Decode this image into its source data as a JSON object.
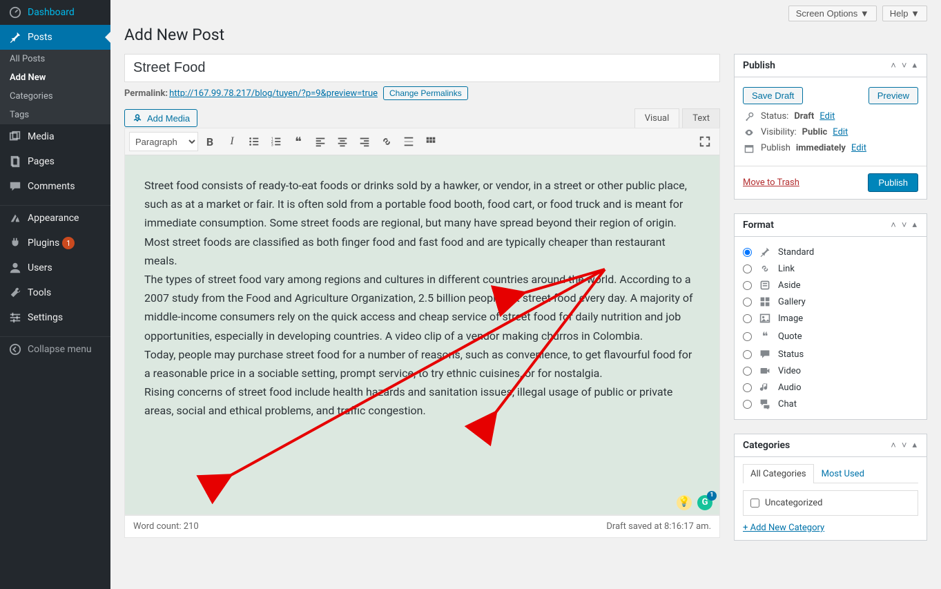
{
  "topbar": {
    "screen_options": "Screen Options ▼",
    "help": "Help ▼"
  },
  "sidebar": {
    "dashboard": "Dashboard",
    "posts": "Posts",
    "posts_submenu": [
      "All Posts",
      "Add New",
      "Categories",
      "Tags"
    ],
    "media": "Media",
    "pages": "Pages",
    "comments": "Comments",
    "appearance": "Appearance",
    "plugins": "Plugins",
    "plugins_badge": "1",
    "users": "Users",
    "tools": "Tools",
    "settings": "Settings",
    "collapse": "Collapse menu"
  },
  "page": {
    "title": "Add New Post"
  },
  "post": {
    "title": "Street Food",
    "permalink_label": "Permalink:",
    "permalink_url": "http://167.99.78.217/blog/tuyen/?p=9&preview=true",
    "change_permalinks": "Change Permalinks",
    "add_media": "Add Media",
    "tabs": {
      "visual": "Visual",
      "text": "Text"
    },
    "format_select": "Paragraph",
    "body": {
      "p1": "Street food consists of ready-to-eat foods or drinks sold by a hawker, or vendor, in a street or other public place, such as at a market or fair. It is often sold from a portable food booth, food cart, or food truck and is meant for immediate consumption. Some street foods are regional, but many have spread beyond their region of origin. Most street foods are classified as both finger food and fast food and are typically cheaper than restaurant meals.",
      "p2": "The types of street food vary among regions and cultures in different countries around the world. According to a 2007 study from the Food and Agriculture Organization, 2.5 billion people eat street food every day. A majority of middle-income consumers rely on the quick access and cheap service of street food for daily nutrition and job opportunities, especially in developing countries. A video clip of a vendor making churros in Colombia.",
      "p3": "Today, people may purchase street food for a number of reasons, such as convenience, to get flavourful food for a reasonable price in a sociable setting, prompt service, to try ethnic cuisines, or for nostalgia.",
      "p4": "Rising concerns of street food include health hazards and sanitation issues, illegal usage of public or private areas, social and ethical problems, and traffic congestion."
    },
    "word_count_label": "Word count: ",
    "word_count": "210",
    "draft_saved": "Draft saved at 8:16:17 am."
  },
  "publish": {
    "title": "Publish",
    "save_draft": "Save Draft",
    "preview": "Preview",
    "status_label": "Status:",
    "status_value": "Draft",
    "visibility_label": "Visibility:",
    "visibility_value": "Public",
    "publish_label": "Publish",
    "publish_value": "immediately",
    "edit": "Edit",
    "trash": "Move to Trash",
    "publish_btn": "Publish"
  },
  "format": {
    "title": "Format",
    "options": [
      "Standard",
      "Link",
      "Aside",
      "Gallery",
      "Image",
      "Quote",
      "Status",
      "Video",
      "Audio",
      "Chat"
    ],
    "selected": "Standard"
  },
  "categories": {
    "title": "Categories",
    "all_tab": "All Categories",
    "most_tab": "Most Used",
    "items": [
      "Uncategorized"
    ],
    "add_new": "+ Add New Category"
  }
}
